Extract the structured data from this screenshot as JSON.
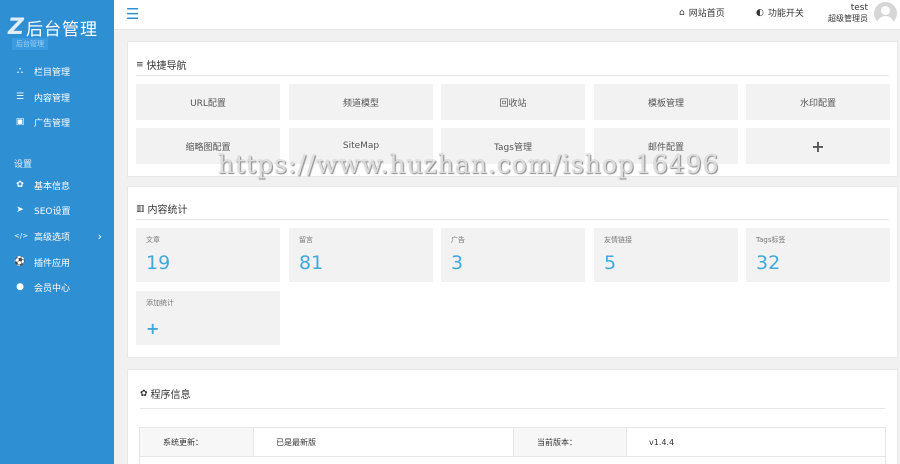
{
  "sidebar": {
    "logo_mark": "Z",
    "logo_text": "后台管理",
    "logo_sub": "后台管理",
    "items": [
      {
        "icon": "sitemap-icon",
        "glyph": "⛬",
        "label": "栏目管理"
      },
      {
        "icon": "list-icon",
        "glyph": "☰",
        "label": "内容管理"
      },
      {
        "icon": "image-icon",
        "glyph": "▣",
        "label": "广告管理"
      }
    ],
    "section_label": "设置",
    "settings_items": [
      {
        "icon": "gear-icon",
        "glyph": "✿",
        "label": "基本信息"
      },
      {
        "icon": "paper-plane-icon",
        "glyph": "➤",
        "label": "SEO设置"
      },
      {
        "icon": "code-icon",
        "glyph": "</>",
        "label": "高级选项",
        "chevron": "›"
      },
      {
        "icon": "soccer-ball-icon",
        "glyph": "⚽",
        "label": "插件应用"
      },
      {
        "icon": "user-icon",
        "glyph": "●",
        "label": "会员中心"
      }
    ]
  },
  "topbar": {
    "menu_glyph": "☰",
    "home_link": "网站首页",
    "toggle_link": "功能开关",
    "user_name": "test",
    "user_role": "超级管理员"
  },
  "quick_nav": {
    "title": "快捷导航",
    "tiles": [
      "URL配置",
      "频道模型",
      "回收站",
      "模板管理",
      "水印配置",
      "缩略图配置",
      "SiteMap",
      "Tags管理",
      "邮件配置",
      "+"
    ]
  },
  "content_stats": {
    "title": "内容统计",
    "stats": [
      {
        "label": "文章",
        "value": "19"
      },
      {
        "label": "留言",
        "value": "81"
      },
      {
        "label": "广告",
        "value": "3"
      },
      {
        "label": "友情链接",
        "value": "5"
      },
      {
        "label": "Tags标签",
        "value": "32"
      }
    ],
    "add_label": "添加统计",
    "add_glyph": "+"
  },
  "program_info": {
    "title": "程序信息",
    "update_label": "系统更新：",
    "update_value": "已是最新版",
    "version_label": "当前版本：",
    "version_value": "v1.4.4"
  },
  "watermark": "https://www.huzhan.com/ishop16496",
  "colors": {
    "sidebar": "#2f8fd3",
    "accent": "#42a8d8",
    "tile": "#f2f2f2"
  }
}
